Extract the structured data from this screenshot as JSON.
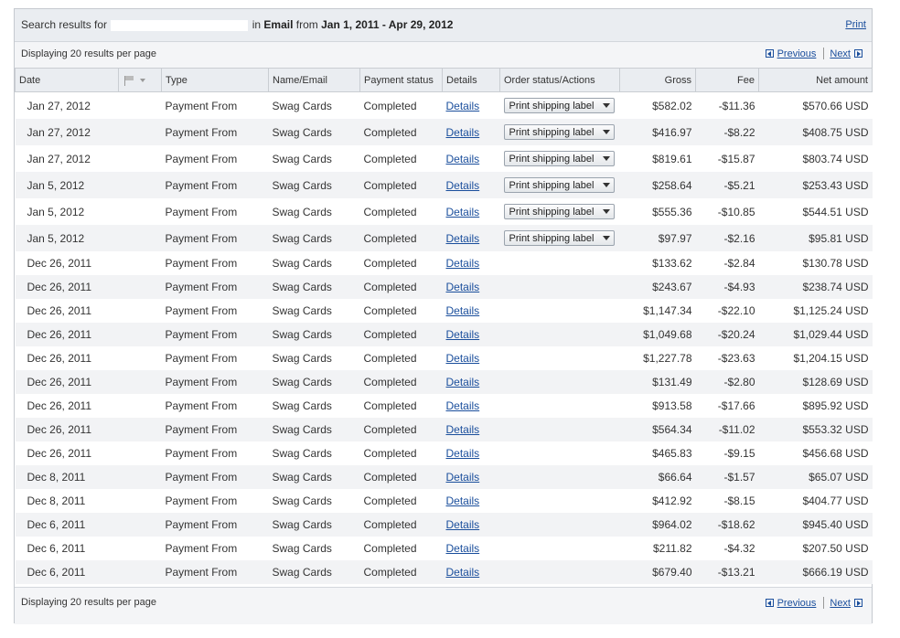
{
  "search": {
    "prefix": "Search results for",
    "middle": "in",
    "field": "Email",
    "from_label": "from",
    "range": "Jan 1, 2011 - Apr 29, 2012",
    "print_label": "Print"
  },
  "pagination": {
    "per_page_text": "Displaying 20 results per page",
    "previous_label": "Previous",
    "next_label": "Next"
  },
  "columns": {
    "date": "Date",
    "flag_icon": "flag-icon",
    "type": "Type",
    "name": "Name/Email",
    "status": "Payment status",
    "details": "Details",
    "order": "Order status/Actions",
    "gross": "Gross",
    "fee": "Fee",
    "net": "Net amount"
  },
  "ship_label": "Print shipping label",
  "rows": [
    {
      "date": "Jan 27, 2012",
      "type": "Payment From",
      "name": "Swag Cards",
      "status": "Completed",
      "details": "Details",
      "ship": true,
      "gross": "$582.02",
      "fee": "-$11.36",
      "net": "$570.66 USD"
    },
    {
      "date": "Jan 27, 2012",
      "type": "Payment From",
      "name": "Swag Cards",
      "status": "Completed",
      "details": "Details",
      "ship": true,
      "gross": "$416.97",
      "fee": "-$8.22",
      "net": "$408.75 USD"
    },
    {
      "date": "Jan 27, 2012",
      "type": "Payment From",
      "name": "Swag Cards",
      "status": "Completed",
      "details": "Details",
      "ship": true,
      "gross": "$819.61",
      "fee": "-$15.87",
      "net": "$803.74 USD"
    },
    {
      "date": "Jan 5, 2012",
      "type": "Payment From",
      "name": "Swag Cards",
      "status": "Completed",
      "details": "Details",
      "ship": true,
      "gross": "$258.64",
      "fee": "-$5.21",
      "net": "$253.43 USD"
    },
    {
      "date": "Jan 5, 2012",
      "type": "Payment From",
      "name": "Swag Cards",
      "status": "Completed",
      "details": "Details",
      "ship": true,
      "gross": "$555.36",
      "fee": "-$10.85",
      "net": "$544.51 USD"
    },
    {
      "date": "Jan 5, 2012",
      "type": "Payment From",
      "name": "Swag Cards",
      "status": "Completed",
      "details": "Details",
      "ship": true,
      "gross": "$97.97",
      "fee": "-$2.16",
      "net": "$95.81 USD"
    },
    {
      "date": "Dec 26, 2011",
      "type": "Payment From",
      "name": "Swag Cards",
      "status": "Completed",
      "details": "Details",
      "ship": false,
      "gross": "$133.62",
      "fee": "-$2.84",
      "net": "$130.78 USD"
    },
    {
      "date": "Dec 26, 2011",
      "type": "Payment From",
      "name": "Swag Cards",
      "status": "Completed",
      "details": "Details",
      "ship": false,
      "gross": "$243.67",
      "fee": "-$4.93",
      "net": "$238.74 USD"
    },
    {
      "date": "Dec 26, 2011",
      "type": "Payment From",
      "name": "Swag Cards",
      "status": "Completed",
      "details": "Details",
      "ship": false,
      "gross": "$1,147.34",
      "fee": "-$22.10",
      "net": "$1,125.24 USD"
    },
    {
      "date": "Dec 26, 2011",
      "type": "Payment From",
      "name": "Swag Cards",
      "status": "Completed",
      "details": "Details",
      "ship": false,
      "gross": "$1,049.68",
      "fee": "-$20.24",
      "net": "$1,029.44 USD"
    },
    {
      "date": "Dec 26, 2011",
      "type": "Payment From",
      "name": "Swag Cards",
      "status": "Completed",
      "details": "Details",
      "ship": false,
      "gross": "$1,227.78",
      "fee": "-$23.63",
      "net": "$1,204.15 USD"
    },
    {
      "date": "Dec 26, 2011",
      "type": "Payment From",
      "name": "Swag Cards",
      "status": "Completed",
      "details": "Details",
      "ship": false,
      "gross": "$131.49",
      "fee": "-$2.80",
      "net": "$128.69 USD"
    },
    {
      "date": "Dec 26, 2011",
      "type": "Payment From",
      "name": "Swag Cards",
      "status": "Completed",
      "details": "Details",
      "ship": false,
      "gross": "$913.58",
      "fee": "-$17.66",
      "net": "$895.92 USD"
    },
    {
      "date": "Dec 26, 2011",
      "type": "Payment From",
      "name": "Swag Cards",
      "status": "Completed",
      "details": "Details",
      "ship": false,
      "gross": "$564.34",
      "fee": "-$11.02",
      "net": "$553.32 USD"
    },
    {
      "date": "Dec 26, 2011",
      "type": "Payment From",
      "name": "Swag Cards",
      "status": "Completed",
      "details": "Details",
      "ship": false,
      "gross": "$465.83",
      "fee": "-$9.15",
      "net": "$456.68 USD"
    },
    {
      "date": "Dec 8, 2011",
      "type": "Payment From",
      "name": "Swag Cards",
      "status": "Completed",
      "details": "Details",
      "ship": false,
      "gross": "$66.64",
      "fee": "-$1.57",
      "net": "$65.07 USD"
    },
    {
      "date": "Dec 8, 2011",
      "type": "Payment From",
      "name": "Swag Cards",
      "status": "Completed",
      "details": "Details",
      "ship": false,
      "gross": "$412.92",
      "fee": "-$8.15",
      "net": "$404.77 USD"
    },
    {
      "date": "Dec 6, 2011",
      "type": "Payment From",
      "name": "Swag Cards",
      "status": "Completed",
      "details": "Details",
      "ship": false,
      "gross": "$964.02",
      "fee": "-$18.62",
      "net": "$945.40 USD"
    },
    {
      "date": "Dec 6, 2011",
      "type": "Payment From",
      "name": "Swag Cards",
      "status": "Completed",
      "details": "Details",
      "ship": false,
      "gross": "$211.82",
      "fee": "-$4.32",
      "net": "$207.50 USD"
    },
    {
      "date": "Dec 6, 2011",
      "type": "Payment From",
      "name": "Swag Cards",
      "status": "Completed",
      "details": "Details",
      "ship": false,
      "gross": "$679.40",
      "fee": "-$13.21",
      "net": "$666.19 USD"
    }
  ],
  "colors": {
    "link": "#1a4e9c",
    "header_bg": "#eaedf1",
    "stripe": "#f2f3f5"
  }
}
